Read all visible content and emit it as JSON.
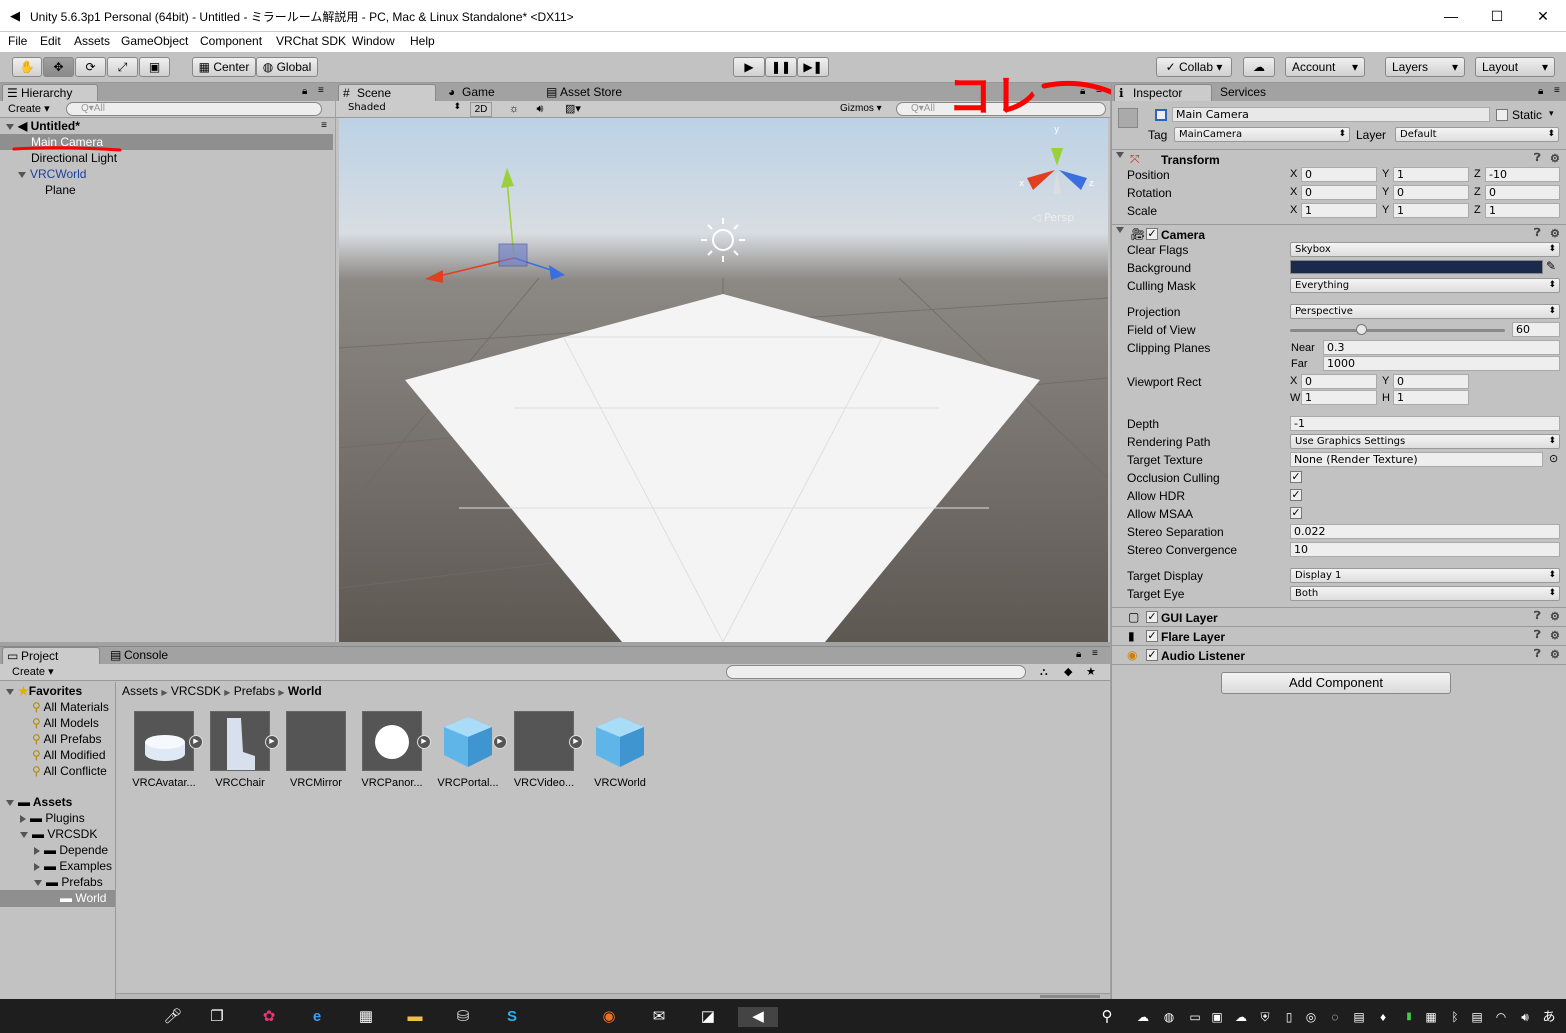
{
  "window": {
    "title": "Unity 5.6.3p1 Personal (64bit) - Untitled - ミラールーム解説用 - PC, Mac & Linux Standalone* <DX11>",
    "minimize": "—",
    "maximize": "☐",
    "close": "✕"
  },
  "menu": [
    "File",
    "Edit",
    "Assets",
    "GameObject",
    "Component",
    "VRChat SDK",
    "Window",
    "Help"
  ],
  "toolbar": {
    "tools": [
      "hand-icon",
      "move-icon",
      "rotate-icon",
      "scale-icon",
      "rect-icon"
    ],
    "center": "Center",
    "global": "Global",
    "collab": "Collab ▾",
    "account": "Account",
    "layers": "Layers",
    "layout": "Layout"
  },
  "hierarchy": {
    "tab": "Hierarchy",
    "create": "Create ▾",
    "search_placeholder": "Q▾All",
    "scene": "Untitled*",
    "items": [
      "Main Camera",
      "Directional Light",
      "VRCWorld",
      "Plane"
    ]
  },
  "scene_view": {
    "tabs": [
      "Scene",
      "Game",
      "Asset Store"
    ],
    "shading": "Shaded",
    "mode2d": "2D",
    "gizmos": "Gizmos",
    "search_placeholder": "Q▾All",
    "persp": "◁ Persp",
    "gizmo_axes": [
      "y",
      "x",
      "z"
    ]
  },
  "annotation": {
    "text": "コレ",
    "color": "#ff0000"
  },
  "inspector": {
    "tabs": [
      "Inspector",
      "Services"
    ],
    "object_name": "Main Camera",
    "static_label": "Static",
    "tag_label": "Tag",
    "tag_value": "MainCamera",
    "layer_label": "Layer",
    "layer_value": "Default",
    "transform": {
      "title": "Transform",
      "position_label": "Position",
      "position": [
        "0",
        "1",
        "-10"
      ],
      "rotation_label": "Rotation",
      "rotation": [
        "0",
        "0",
        "0"
      ],
      "scale_label": "Scale",
      "scale": [
        "1",
        "1",
        "1"
      ],
      "axis": [
        "X",
        "Y",
        "Z"
      ]
    },
    "camera": {
      "title": "Camera",
      "clear_flags_label": "Clear Flags",
      "clear_flags": "Skybox",
      "background_label": "Background",
      "background_color": "#192a4a",
      "culling_label": "Culling Mask",
      "culling": "Everything",
      "projection_label": "Projection",
      "projection": "Perspective",
      "fov_label": "Field of View",
      "fov": "60",
      "clipping_label": "Clipping Planes",
      "near_label": "Near",
      "near": "0.3",
      "far_label": "Far",
      "far": "1000",
      "viewport_label": "Viewport Rect",
      "vx": "0",
      "vy": "0",
      "vw": "1",
      "vh": "1",
      "vp_x": "X",
      "vp_y": "Y",
      "vp_w": "W",
      "vp_h": "H",
      "depth_label": "Depth",
      "depth": "-1",
      "rendering_label": "Rendering Path",
      "rendering": "Use Graphics Settings",
      "target_texture_label": "Target Texture",
      "target_texture": "None (Render Texture)",
      "occlusion_label": "Occlusion Culling",
      "hdr_label": "Allow HDR",
      "msaa_label": "Allow MSAA",
      "stereo_sep_label": "Stereo Separation",
      "stereo_sep": "0.022",
      "stereo_conv_label": "Stereo Convergence",
      "stereo_conv": "10",
      "target_display_label": "Target Display",
      "target_display": "Display 1",
      "target_eye_label": "Target Eye",
      "target_eye": "Both",
      "check": "✓"
    },
    "gui_layer": "GUI Layer",
    "flare_layer": "Flare Layer",
    "audio_listener": "Audio Listener",
    "add_component": "Add Component"
  },
  "project": {
    "tabs": [
      "Project",
      "Console"
    ],
    "create": "Create ▾",
    "favorites_label": "Favorites",
    "favorites": [
      "All Materials",
      "All Models",
      "All Prefabs",
      "All Modified",
      "All Conflicte"
    ],
    "assets_label": "Assets",
    "tree": [
      "Plugins",
      "VRCSDK",
      "Depende",
      "Examples",
      "Prefabs",
      "World"
    ],
    "breadcrumb": [
      "Assets",
      "VRCSDK",
      "Prefabs",
      "World"
    ],
    "assets": [
      "VRCAvatar...",
      "VRCChair",
      "VRCMirror",
      "VRCPanor...",
      "VRCPortal...",
      "VRCVideo...",
      "VRCWorld"
    ]
  },
  "taskbar": {
    "icons": [
      "mic-icon",
      "task-view-icon",
      "paint-icon",
      "edge-icon",
      "calculator-icon",
      "explorer-icon",
      "store-icon",
      "skype-icon",
      "firefox-icon",
      "mail-icon",
      "sticky-notes-icon",
      "unity-icon"
    ],
    "ime": "あ"
  }
}
